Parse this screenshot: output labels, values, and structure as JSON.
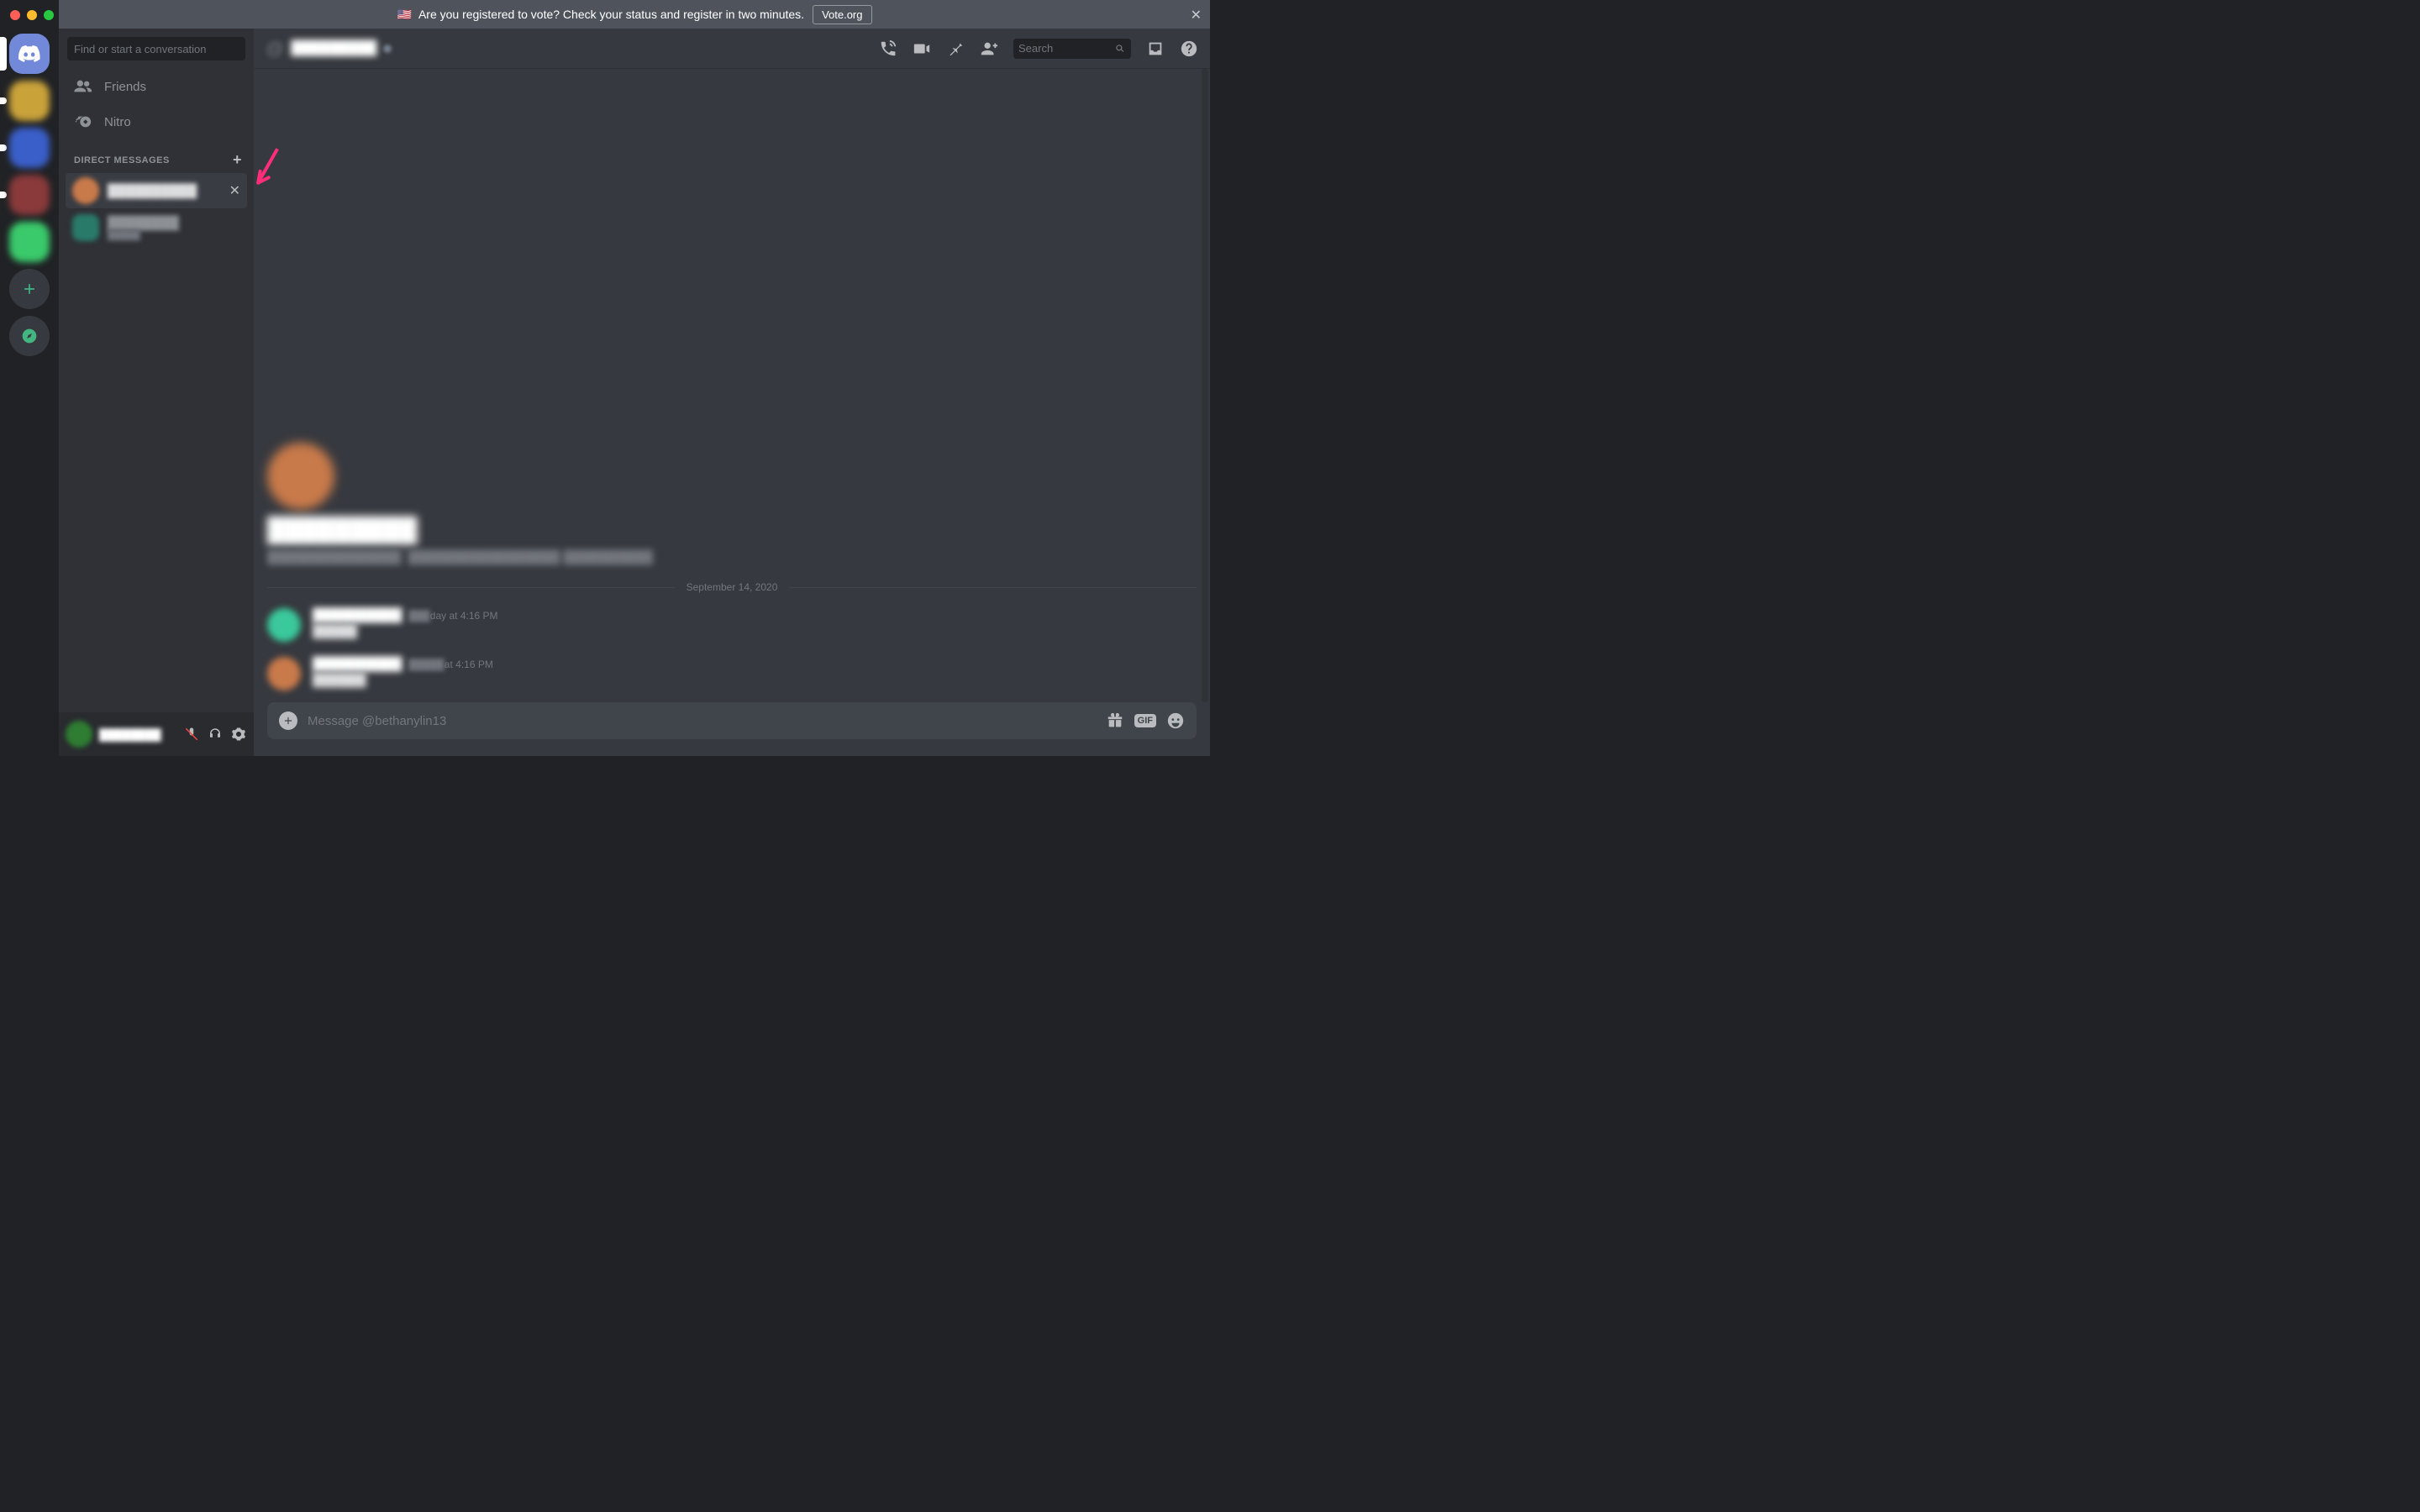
{
  "notice": {
    "text": "Are you registered to vote? Check your status and register in two minutes.",
    "button": "Vote.org",
    "flag": "🇺🇸"
  },
  "sidebar": {
    "find_placeholder": "Find or start a conversation",
    "friends_label": "Friends",
    "nitro_label": "Nitro",
    "dm_header": "DIRECT MESSAGES",
    "dm_items": [
      {
        "name": "██████████"
      },
      {
        "name": "████████",
        "sub": "█████"
      }
    ]
  },
  "user_footer": {
    "username": "████████"
  },
  "chat": {
    "header_name": "█████████",
    "search_placeholder": "Search",
    "welcome_name": "█████████",
    "welcome_desc_a": "███████████████",
    "welcome_desc_b": "█████████████████  ██████████",
    "divider_date": "September 14, 2020",
    "messages": [
      {
        "name": "██████████",
        "time_blurred": "███",
        "time_visible": "day at 4:16 PM",
        "body": "█████"
      },
      {
        "name": "██████████",
        "time_blurred": "█████",
        "time_visible": "at 4:16 PM",
        "body": "██████"
      }
    ],
    "composer_placeholder": "Message @bethanylin13",
    "gif_label": "GIF"
  }
}
